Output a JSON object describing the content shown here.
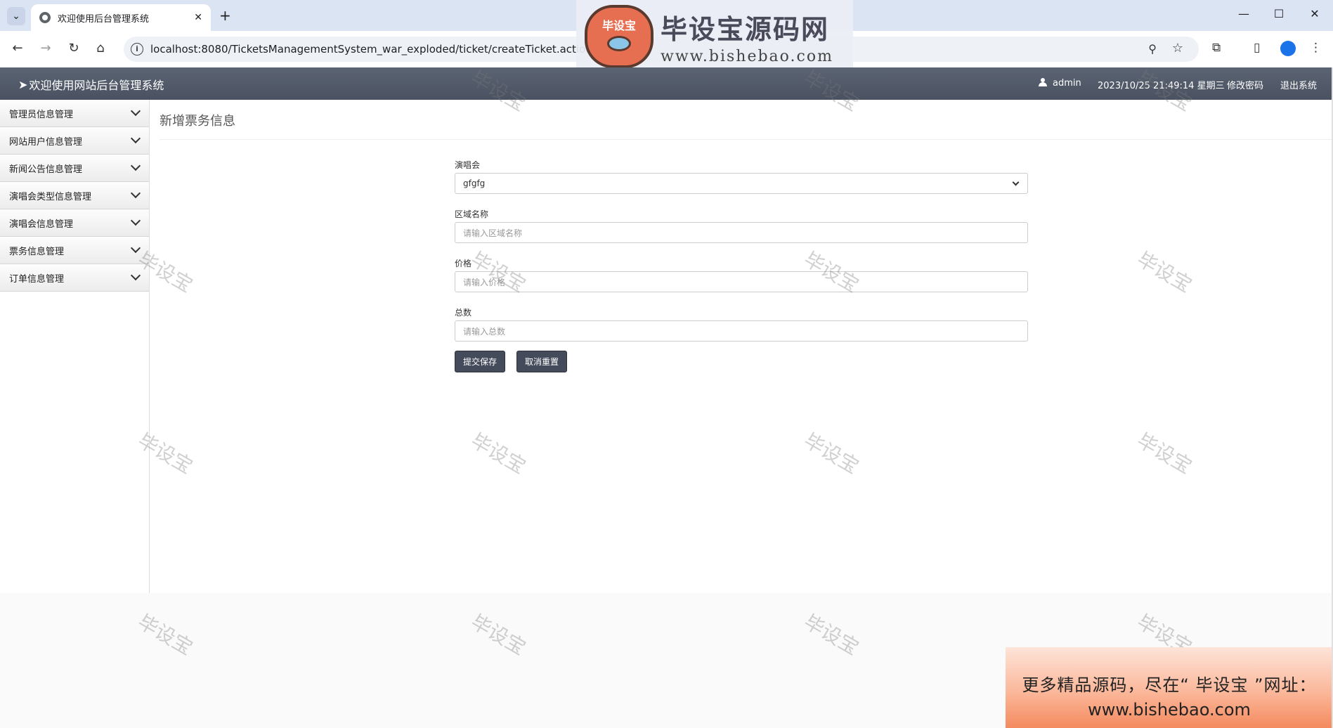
{
  "browser": {
    "tab_title": "欢迎使用后台管理系统",
    "url": "localhost:8080/TicketsManagementSystem_war_exploded/ticket/createTicket.action",
    "tab_menu_glyph": "⌄",
    "new_tab_glyph": "+",
    "close_glyph": "✕",
    "minimize_glyph": "—",
    "maximize_glyph": "☐",
    "window_close_glyph": "✕",
    "back_glyph": "←",
    "forward_glyph": "→",
    "reload_glyph": "↻",
    "home_glyph": "⌂",
    "info_glyph": "i",
    "zoom_glyph": "⚲",
    "star_glyph": "☆",
    "extensions_glyph": "⧉",
    "sidepanel_glyph": "▯",
    "more_glyph": "⋮"
  },
  "watermark": {
    "logo_text": "毕设宝",
    "title": "毕设宝源码网",
    "url": "www.bishebao.com",
    "diagonal": "毕设宝"
  },
  "header": {
    "brand_icon": "➤",
    "brand": "欢迎使用网站后台管理系统",
    "user": "admin",
    "datetime": "2023/10/25 21:49:14 星期三",
    "change_password": "修改密码",
    "logout": "退出系统"
  },
  "sidebar": {
    "items": [
      {
        "label": "管理员信息管理"
      },
      {
        "label": "网站用户信息管理"
      },
      {
        "label": "新闻公告信息管理"
      },
      {
        "label": "演唱会类型信息管理"
      },
      {
        "label": "演唱会信息管理"
      },
      {
        "label": "票务信息管理"
      },
      {
        "label": "订单信息管理"
      }
    ]
  },
  "main": {
    "page_title": "新增票务信息",
    "form": {
      "concert_label": "演唱会",
      "concert_value": "gfgfg",
      "area_label": "区域名称",
      "area_placeholder": "请输入区域名称",
      "price_label": "价格",
      "price_placeholder": "请输入价格",
      "total_label": "总数",
      "total_placeholder": "请输入总数",
      "submit": "提交保存",
      "reset": "取消重置"
    }
  },
  "ad": {
    "line1": "更多精品源码，尽在“ 毕设宝 ”网址：",
    "line2": "www.bishebao.com"
  }
}
